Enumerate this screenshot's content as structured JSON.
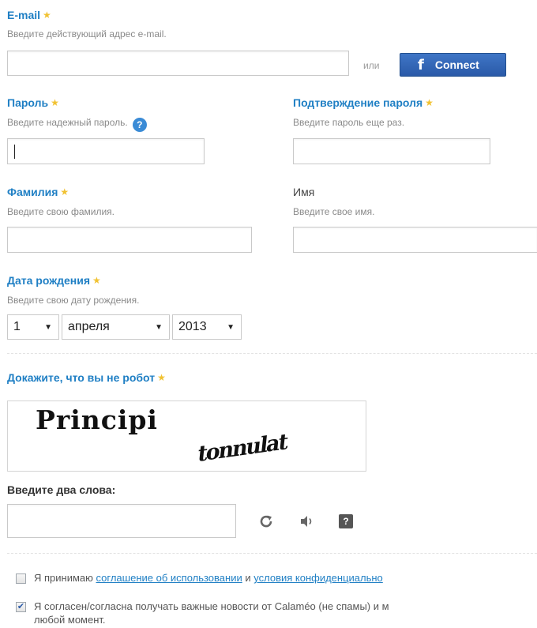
{
  "email": {
    "label": "E-mail",
    "hint": "Введите действующий адрес e-mail.",
    "value": "",
    "or_text": "или",
    "facebook_label": "Connect"
  },
  "password": {
    "label": "Пароль",
    "hint": "Введите надежный пароль.",
    "help": "?",
    "value": ""
  },
  "password_confirm": {
    "label": "Подтверждение пароля",
    "hint": "Введите пароль еще раз.",
    "value": ""
  },
  "last_name": {
    "label": "Фамилия",
    "hint": "Введите свою фамилия.",
    "value": ""
  },
  "first_name": {
    "label": "Имя",
    "hint": "Введите свое имя.",
    "value": ""
  },
  "birthdate": {
    "label": "Дата рождения",
    "hint": "Введите свою дату рождения.",
    "day": "1",
    "month": "апреля",
    "year": "2013"
  },
  "captcha": {
    "title": "Докажите, что вы не робот",
    "word1": "Principi",
    "word2": "tonnulat",
    "prompt": "Введите два слова:",
    "value": ""
  },
  "consent": {
    "terms_prefix": "Я принимаю",
    "terms_link": "соглашение об использовании",
    "terms_and": "и",
    "privacy_link": "условия конфиденциально",
    "terms_checked": false,
    "news_line1": "Я согласен/согласна получать важные новости от Calaméo (не спамы) и м",
    "news_line2": "любой момент.",
    "news_checked": true
  },
  "colors": {
    "label_blue": "#1f7fc4",
    "facebook_blue": "#3b6cb7",
    "star_gold": "#f1c232"
  },
  "icons": [
    "star-icon",
    "help-icon",
    "facebook-icon",
    "refresh-icon",
    "audio-icon",
    "captcha-help-icon",
    "checkbox-icon"
  ]
}
